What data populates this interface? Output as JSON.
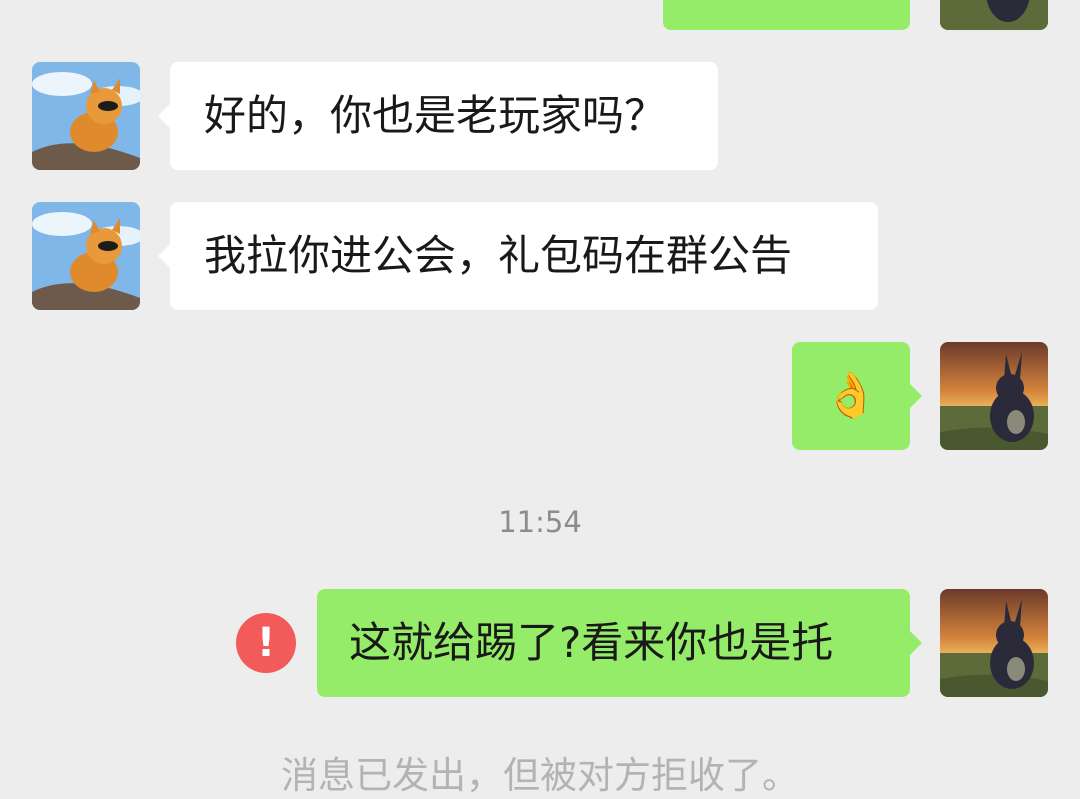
{
  "messages": [
    {
      "side": "right",
      "text": ""
    },
    {
      "side": "left",
      "text": "好的，你也是老玩家吗？"
    },
    {
      "side": "left",
      "text": "我拉你进公会，礼包码在群公告"
    },
    {
      "side": "right",
      "text": "👌"
    },
    {
      "side": "right",
      "text": "这就给踢了?看来你也是托",
      "status": "failed"
    }
  ],
  "timestamp": "11:54",
  "fail_icon": "!",
  "system_notice": "消息已发出，但被对方拒收了。",
  "colors": {
    "background": "#ededed",
    "sent_bubble": "#95ec69",
    "received_bubble": "#ffffff",
    "error": "#f35a5a"
  }
}
